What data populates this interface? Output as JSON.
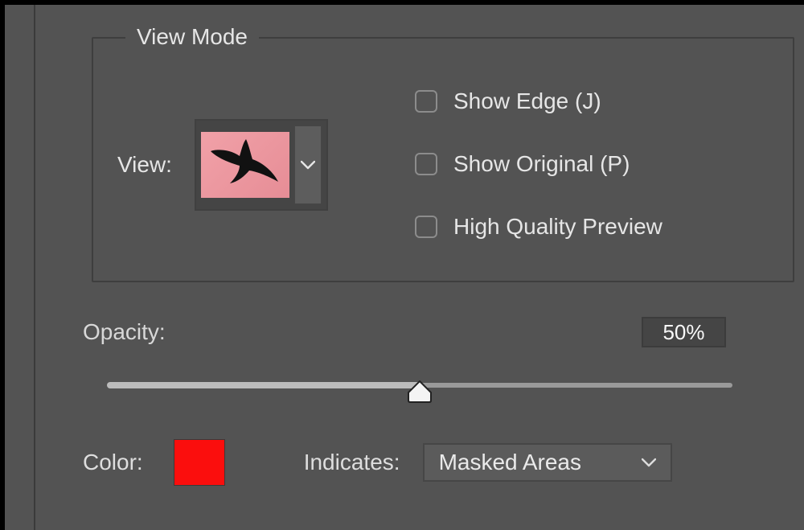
{
  "viewMode": {
    "legend": "View Mode",
    "viewLabel": "View:",
    "checkboxes": {
      "showEdge": {
        "label": "Show Edge (J)",
        "checked": false
      },
      "showOriginal": {
        "label": "Show Original (P)",
        "checked": false
      },
      "highQuality": {
        "label": "High Quality Preview",
        "checked": false
      }
    }
  },
  "opacity": {
    "label": "Opacity:",
    "value": "50%",
    "percent": 50
  },
  "color": {
    "label": "Color:",
    "hex": "#fb0e0d"
  },
  "indicates": {
    "label": "Indicates:",
    "selected": "Masked Areas"
  }
}
